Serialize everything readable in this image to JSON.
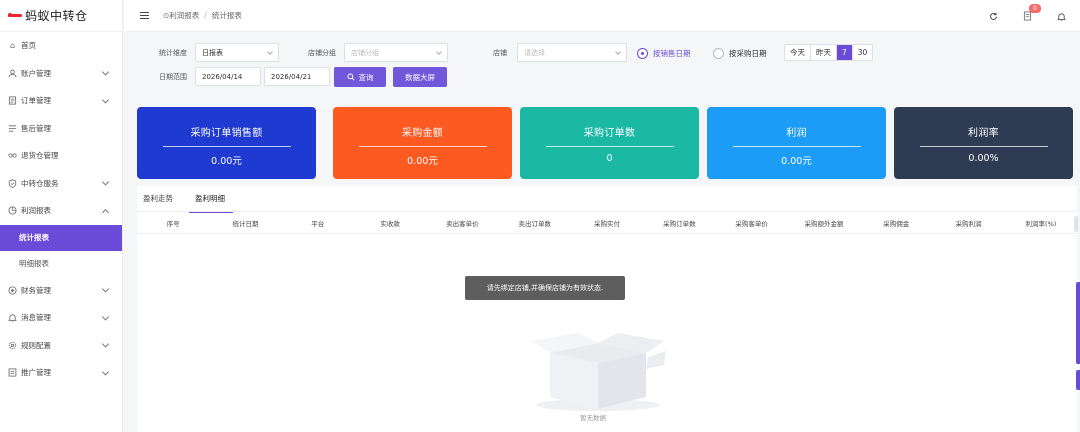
{
  "app": {
    "logo_text": "蚂蚁中转仓"
  },
  "sidebar": {
    "items": [
      {
        "label": "首页",
        "icon": "home-icon",
        "has_children": false
      },
      {
        "label": "账户管理",
        "icon": "user-icon",
        "has_children": true
      },
      {
        "label": "订单管理",
        "icon": "order-icon",
        "has_children": true
      },
      {
        "label": "售后管理",
        "icon": "after-sale-icon",
        "has_children": false
      },
      {
        "label": "退货仓管理",
        "icon": "return-icon",
        "has_children": false
      },
      {
        "label": "中转仓服务",
        "icon": "shield-icon",
        "has_children": true
      },
      {
        "label": "利润报表",
        "icon": "report-icon",
        "has_children": true,
        "expanded": true
      }
    ],
    "subitems": [
      {
        "label": "统计报表",
        "active": true
      },
      {
        "label": "明细报表",
        "active": false
      }
    ],
    "items_after": [
      {
        "label": "财务管理",
        "icon": "finance-icon"
      },
      {
        "label": "消息管理",
        "icon": "bell-icon"
      },
      {
        "label": "规则配置",
        "icon": "gear-icon"
      },
      {
        "label": "推广管理",
        "icon": "promote-icon"
      }
    ]
  },
  "header": {
    "breadcrumb": [
      "利润报表",
      "统计报表"
    ],
    "notification_count": "0"
  },
  "filters": {
    "dimension_label": "统计维度",
    "dimension_value": "日报表",
    "shop_group_label": "店铺分组",
    "shop_group_placeholder": "店铺分组",
    "shop_label": "店铺",
    "shop_placeholder": "请选择",
    "radio_sale_date": "按销售日期",
    "radio_purchase_date": "按采购日期",
    "quick_ranges": [
      "今天",
      "昨天",
      "7",
      "30"
    ],
    "quick_selected": "7",
    "date_range_label": "日期范围",
    "date_start": "2026/04/14",
    "date_end": "2026/04/21",
    "search_button": "查询",
    "screen_button": "数据大屏"
  },
  "cards": [
    {
      "title": "采购订单销售额",
      "value": "0.00元",
      "color": "#1f3ad1"
    },
    {
      "title": "采购金额",
      "value": "0.00元",
      "color": "#fd5a22"
    },
    {
      "title": "采购订单数",
      "value": "0",
      "color": "#1bb9a4"
    },
    {
      "title": "利润",
      "value": "0.00元",
      "color": "#1c9cf5"
    },
    {
      "title": "利润率",
      "value": "0.00%",
      "color": "#2f3b52"
    }
  ],
  "tabs": [
    {
      "label": "盈利走势",
      "active": false
    },
    {
      "label": "盈利明细",
      "active": true
    }
  ],
  "table": {
    "columns": [
      "序号",
      "统计日期",
      "平台",
      "实收款",
      "卖出客单价",
      "卖出订单数",
      "采购实付",
      "采购订单数",
      "采购客单价",
      "采购额外金额",
      "采购佣金",
      "采购利润",
      "利润率(%)"
    ]
  },
  "toast": "请先绑定店铺,并确保店铺为有效状态.",
  "empty_text": "暂无数据"
}
